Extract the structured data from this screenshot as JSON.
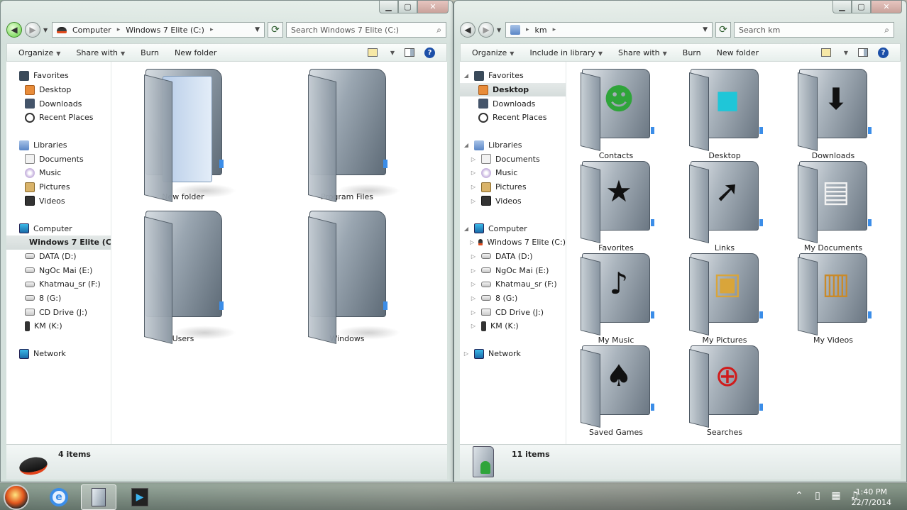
{
  "left": {
    "address": {
      "crumbs": [
        "Computer",
        "Windows 7 Elite (C:)"
      ]
    },
    "search_placeholder": "Search Windows 7 Elite (C:)",
    "toolbar": [
      "Organize",
      "Share with",
      "Burn",
      "New folder"
    ],
    "nav": {
      "favorites": {
        "label": "Favorites",
        "items": [
          "Desktop",
          "Downloads",
          "Recent Places"
        ]
      },
      "libraries": {
        "label": "Libraries",
        "items": [
          "Documents",
          "Music",
          "Pictures",
          "Videos"
        ]
      },
      "computer": {
        "label": "Computer",
        "items": [
          "Windows 7 Elite (C:",
          "DATA (D:)",
          "NgOc Mai (E:)",
          "Khatmau_sr (F:)",
          "8 (G:)",
          "CD Drive (J:)",
          "KM (K:)"
        ]
      },
      "network": "Network"
    },
    "folders": [
      "New folder",
      "Program Files",
      "Users",
      "Windows"
    ],
    "status": "4 items"
  },
  "right": {
    "address": {
      "crumbs": [
        "km"
      ]
    },
    "search_placeholder": "Search km",
    "toolbar": [
      "Organize",
      "Include in library",
      "Share with",
      "Burn",
      "New folder"
    ],
    "nav": {
      "favorites": {
        "label": "Favorites",
        "items": [
          "Desktop",
          "Downloads",
          "Recent Places"
        ]
      },
      "libraries": {
        "label": "Libraries",
        "items": [
          "Documents",
          "Music",
          "Pictures",
          "Videos"
        ]
      },
      "computer": {
        "label": "Computer",
        "items": [
          "Windows 7 Elite (C:)",
          "DATA (D:)",
          "NgOc Mai (E:)",
          "Khatmau_sr (F:)",
          "8 (G:)",
          "CD Drive (J:)",
          "KM (K:)"
        ]
      },
      "network": "Network"
    },
    "folders": [
      {
        "name": "Contacts",
        "icon": "contact-person-icon"
      },
      {
        "name": "Desktop",
        "icon": "desktop-icon"
      },
      {
        "name": "Downloads",
        "icon": "download-arrow-icon"
      },
      {
        "name": "Favorites",
        "icon": "star-icon"
      },
      {
        "name": "Links",
        "icon": "link-arrow-icon"
      },
      {
        "name": "My Documents",
        "icon": "document-icon"
      },
      {
        "name": "My Music",
        "icon": "music-note-icon"
      },
      {
        "name": "My Pictures",
        "icon": "picture-icon"
      },
      {
        "name": "My Videos",
        "icon": "film-icon"
      },
      {
        "name": "Saved Games",
        "icon": "spade-icon"
      },
      {
        "name": "Searches",
        "icon": "search-target-icon"
      }
    ],
    "status": "11 items"
  },
  "taskbar": {
    "time": "1:40 PM",
    "date": "22/7/2014"
  },
  "colors": {
    "accent": "#3b8de8",
    "drive_stripe": "#e24b1d"
  }
}
